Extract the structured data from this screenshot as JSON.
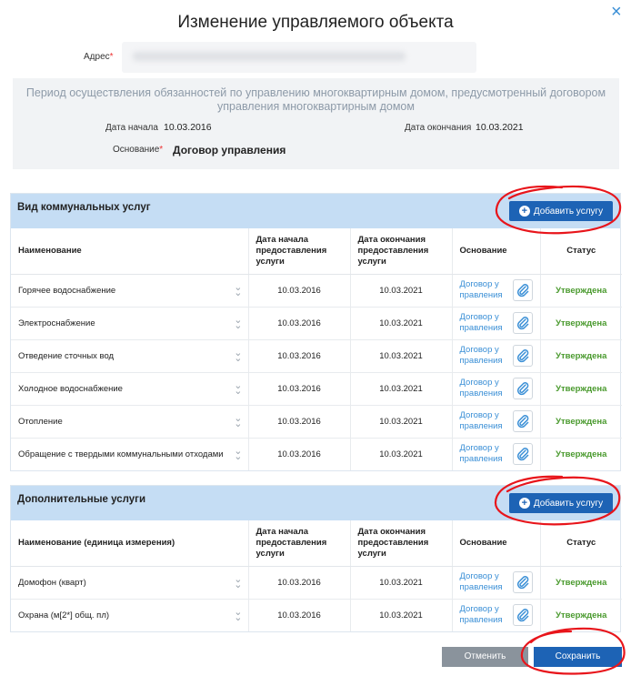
{
  "dialog": {
    "title": "Изменение управляемого объекта",
    "close": "×"
  },
  "address": {
    "label": "Адрес",
    "required": "*",
    "value": ""
  },
  "period": {
    "title": "Период осуществления обязанностей по управлению многоквартирным домом, предусмотренный договором управления многоквартирным домом",
    "start_label": "Дата начала",
    "start_value": "10.03.2016",
    "end_label": "Дата окончания",
    "end_value": "10.03.2021",
    "basis_label": "Основание",
    "basis_required": "*",
    "basis_value": "Договор управления"
  },
  "utilities": {
    "title": "Вид коммунальных услуг",
    "add_button": "Добавить услугу",
    "columns": [
      "Наименование",
      "Дата начала предоставления услуги",
      "Дата окончания предоставления услуги",
      "Основание",
      "Статус"
    ],
    "rows": [
      {
        "name": "Горячее водоснабжение",
        "start": "10.03.2016",
        "end": "10.03.2021",
        "basis": "Договор у правления",
        "status": "Утверждена"
      },
      {
        "name": "Электроснабжение",
        "start": "10.03.2016",
        "end": "10.03.2021",
        "basis": "Договор у правления",
        "status": "Утверждена"
      },
      {
        "name": "Отведение сточных вод",
        "start": "10.03.2016",
        "end": "10.03.2021",
        "basis": "Договор у правления",
        "status": "Утверждена"
      },
      {
        "name": "Холодное водоснабжение",
        "start": "10.03.2016",
        "end": "10.03.2021",
        "basis": "Договор у правления",
        "status": "Утверждена"
      },
      {
        "name": "Отопление",
        "start": "10.03.2016",
        "end": "10.03.2021",
        "basis": "Договор у правления",
        "status": "Утверждена"
      },
      {
        "name": "Обращение с твердыми коммунальными отходами",
        "start": "10.03.2016",
        "end": "10.03.2021",
        "basis": "Договор у правления",
        "status": "Утверждена"
      }
    ]
  },
  "additional": {
    "title": "Дополнительные услуги",
    "add_button": "Добавить услугу",
    "columns": [
      "Наименование (единица измерения)",
      "Дата начала предоставления услуги",
      "Дата окончания предоставления услуги",
      "Основание",
      "Статус"
    ],
    "rows": [
      {
        "name": "Домофон (кварт)",
        "start": "10.03.2016",
        "end": "10.03.2021",
        "basis": "Договор у правления",
        "status": "Утверждена"
      },
      {
        "name": "Охрана (м[2*] общ. пл)",
        "start": "10.03.2016",
        "end": "10.03.2021",
        "basis": "Договор у правления",
        "status": "Утверждена"
      }
    ]
  },
  "footer": {
    "cancel": "Отменить",
    "save": "Сохранить"
  },
  "colors": {
    "accent": "#1d63b5",
    "status_ok": "#4a9a2e",
    "section_header": "#c5ddf4",
    "annotation": "#e8151b"
  }
}
